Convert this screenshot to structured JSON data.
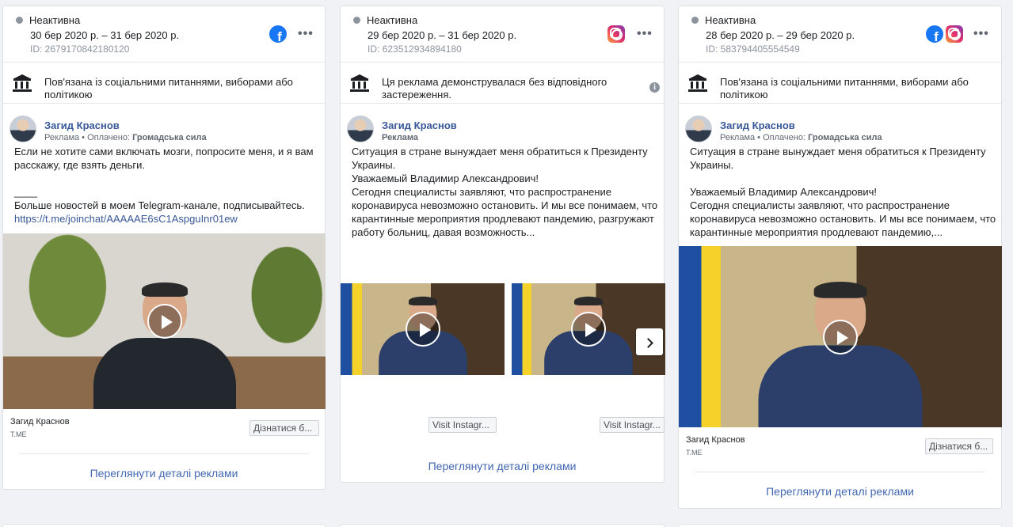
{
  "cards": [
    {
      "status": "Неактивна",
      "dates": "30 бер 2020 р. – 31 бер 2020 р.",
      "id": "ID: 2679170842180120",
      "platforms": [
        "facebook-icon"
      ],
      "notice": "Пов'язана із соціальними питаннями, виборами або політикою",
      "author": "Загид Краснов",
      "author_sub_prefix": "Реклама • Оплачено: ",
      "author_sub_payer": "Громадська сила",
      "text": [
        "Если не хотите сами включать мозги, попросите меня, и я вам расскажу, где взять деньги.",
        "",
        "____",
        "Больше новостей в моем Telegram-канале, подписывайтесь."
      ],
      "link": "https://t.me/joinchat/AAAAAE6sC1AspguInr01ew",
      "cta_name": "Загид Краснов",
      "cta_domain": "T.ME",
      "cta_button": "Дізнатися б...",
      "details": "Переглянути деталі реклами"
    },
    {
      "status": "Неактивна",
      "dates": "29 бер 2020 р. – 31 бер 2020 р.",
      "id": "ID: 623512934894180",
      "platforms": [
        "instagram-icon"
      ],
      "notice": "Ця реклама демонструвалася без відповідного застереження.",
      "author": "Загид Краснов",
      "author_sub_prefix": "Реклама",
      "author_sub_payer": "",
      "text": [
        "Ситуация в стране вынуждает меня обратиться к Президенту Украины.",
        "Уважаемый Владимир Александрович!",
        "Сегодня специалисты заявляют, что распространение коронавируса невозможно остановить. И мы все понимаем, что карантинные мероприятия продлевают пандемию, разгружают работу больниц, давая возможность..."
      ],
      "cta_button_1": "Visit Instagr...",
      "cta_button_2": "Visit Instagr...",
      "details": "Переглянути деталі реклами"
    },
    {
      "status": "Неактивна",
      "dates": "28 бер 2020 р. – 29 бер 2020 р.",
      "id": "ID: 583794405554549",
      "platforms": [
        "facebook-icon",
        "instagram-icon"
      ],
      "notice": "Пов'язана із соціальними питаннями, виборами або політикою",
      "author": "Загид Краснов",
      "author_sub_prefix": "Реклама • Оплачено: ",
      "author_sub_payer": "Громадська сила",
      "text": [
        "Ситуация в стране вынуждает меня обратиться к Президенту Украины.",
        "",
        "Уважаемый Владимир Александрович!",
        "Сегодня специалисты заявляют, что распространение коронавируса невозможно остановить. И мы все понимаем, что карантинные мероприятия продлевают пандемию,..."
      ],
      "cta_name": "Загид Краснов",
      "cta_domain": "T.ME",
      "cta_button": "Дізнатися б...",
      "details": "Переглянути деталі реклами"
    }
  ]
}
